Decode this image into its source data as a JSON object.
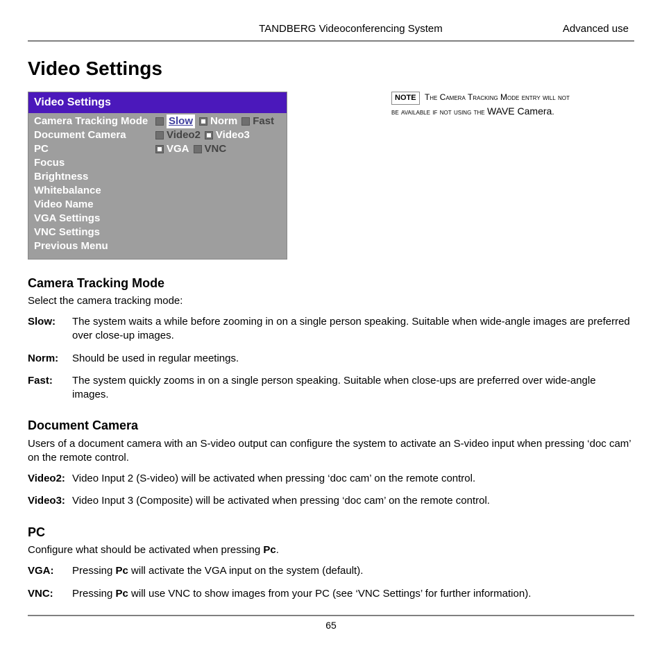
{
  "header": {
    "center": "TANDBERG Videoconferencing System",
    "right": "Advanced use"
  },
  "title": "Video Settings",
  "menu": {
    "title": "Video Settings",
    "rows": [
      {
        "label": "Camera Tracking Mode",
        "options": [
          {
            "text": "Slow",
            "selected": true
          },
          {
            "text": "Norm",
            "selected": false,
            "dot": true
          },
          {
            "text": "Fast",
            "selected": false,
            "dark": true
          }
        ]
      },
      {
        "label": "Document Camera",
        "options": [
          {
            "text": "Video2",
            "selected": false,
            "dark": true
          },
          {
            "text": "Video3",
            "selected": false,
            "dot": true
          }
        ]
      },
      {
        "label": "PC",
        "options": [
          {
            "text": "VGA",
            "selected": false,
            "dot": true
          },
          {
            "text": "VNC",
            "selected": false,
            "dark": true
          }
        ]
      },
      {
        "label": "Focus"
      },
      {
        "label": "Brightness"
      },
      {
        "label": "Whitebalance"
      },
      {
        "label": "Video Name"
      },
      {
        "label": "VGA Settings"
      },
      {
        "label": "VNC Settings"
      },
      {
        "label": "Previous Menu"
      }
    ]
  },
  "note": {
    "tag": "NOTE",
    "text_pre": "The Camera Tracking Mode entry will not be available if not using the ",
    "text_strong": "WAVE Camera",
    "text_post": "."
  },
  "sections": {
    "camera": {
      "heading": "Camera Tracking Mode",
      "intro": "Select the camera tracking mode:",
      "defs": [
        {
          "term": "Slow:",
          "desc": "The system waits a while before zooming in on a single person speaking. Suitable when wide-angle images are preferred over close-up images."
        },
        {
          "term": "Norm:",
          "desc": "Should be used in regular meetings."
        },
        {
          "term": "Fast:",
          "desc": "The system quickly zooms in on a single person speaking. Suitable when close-ups are preferred over wide-angle images."
        }
      ]
    },
    "doc": {
      "heading": "Document Camera",
      "intro": "Users of a document camera with an S-video output can configure the system to activate an S-video input when pressing ‘doc cam’ on the remote control.",
      "defs": [
        {
          "term": "Video2:",
          "desc": "Video Input 2 (S-video) will be activated when pressing ‘doc cam’ on the remote control."
        },
        {
          "term": "Video3:",
          "desc": "Video Input 3 (Composite) will be activated when pressing ‘doc cam’ on the remote control."
        }
      ]
    },
    "pc": {
      "heading": "PC",
      "intro_pre": "Configure what should be activated when pressing ",
      "intro_bold": "Pc",
      "intro_post": ".",
      "defs": [
        {
          "term": "VGA:",
          "pre": "Pressing ",
          "bold": "Pc",
          "post": " will activate the VGA input on the system (default)."
        },
        {
          "term": "VNC:",
          "pre": "Pressing ",
          "bold": "Pc",
          "post": " will use VNC to show images from your PC (see ‘VNC Settings’ for further information)."
        }
      ]
    }
  },
  "page_number": "65"
}
